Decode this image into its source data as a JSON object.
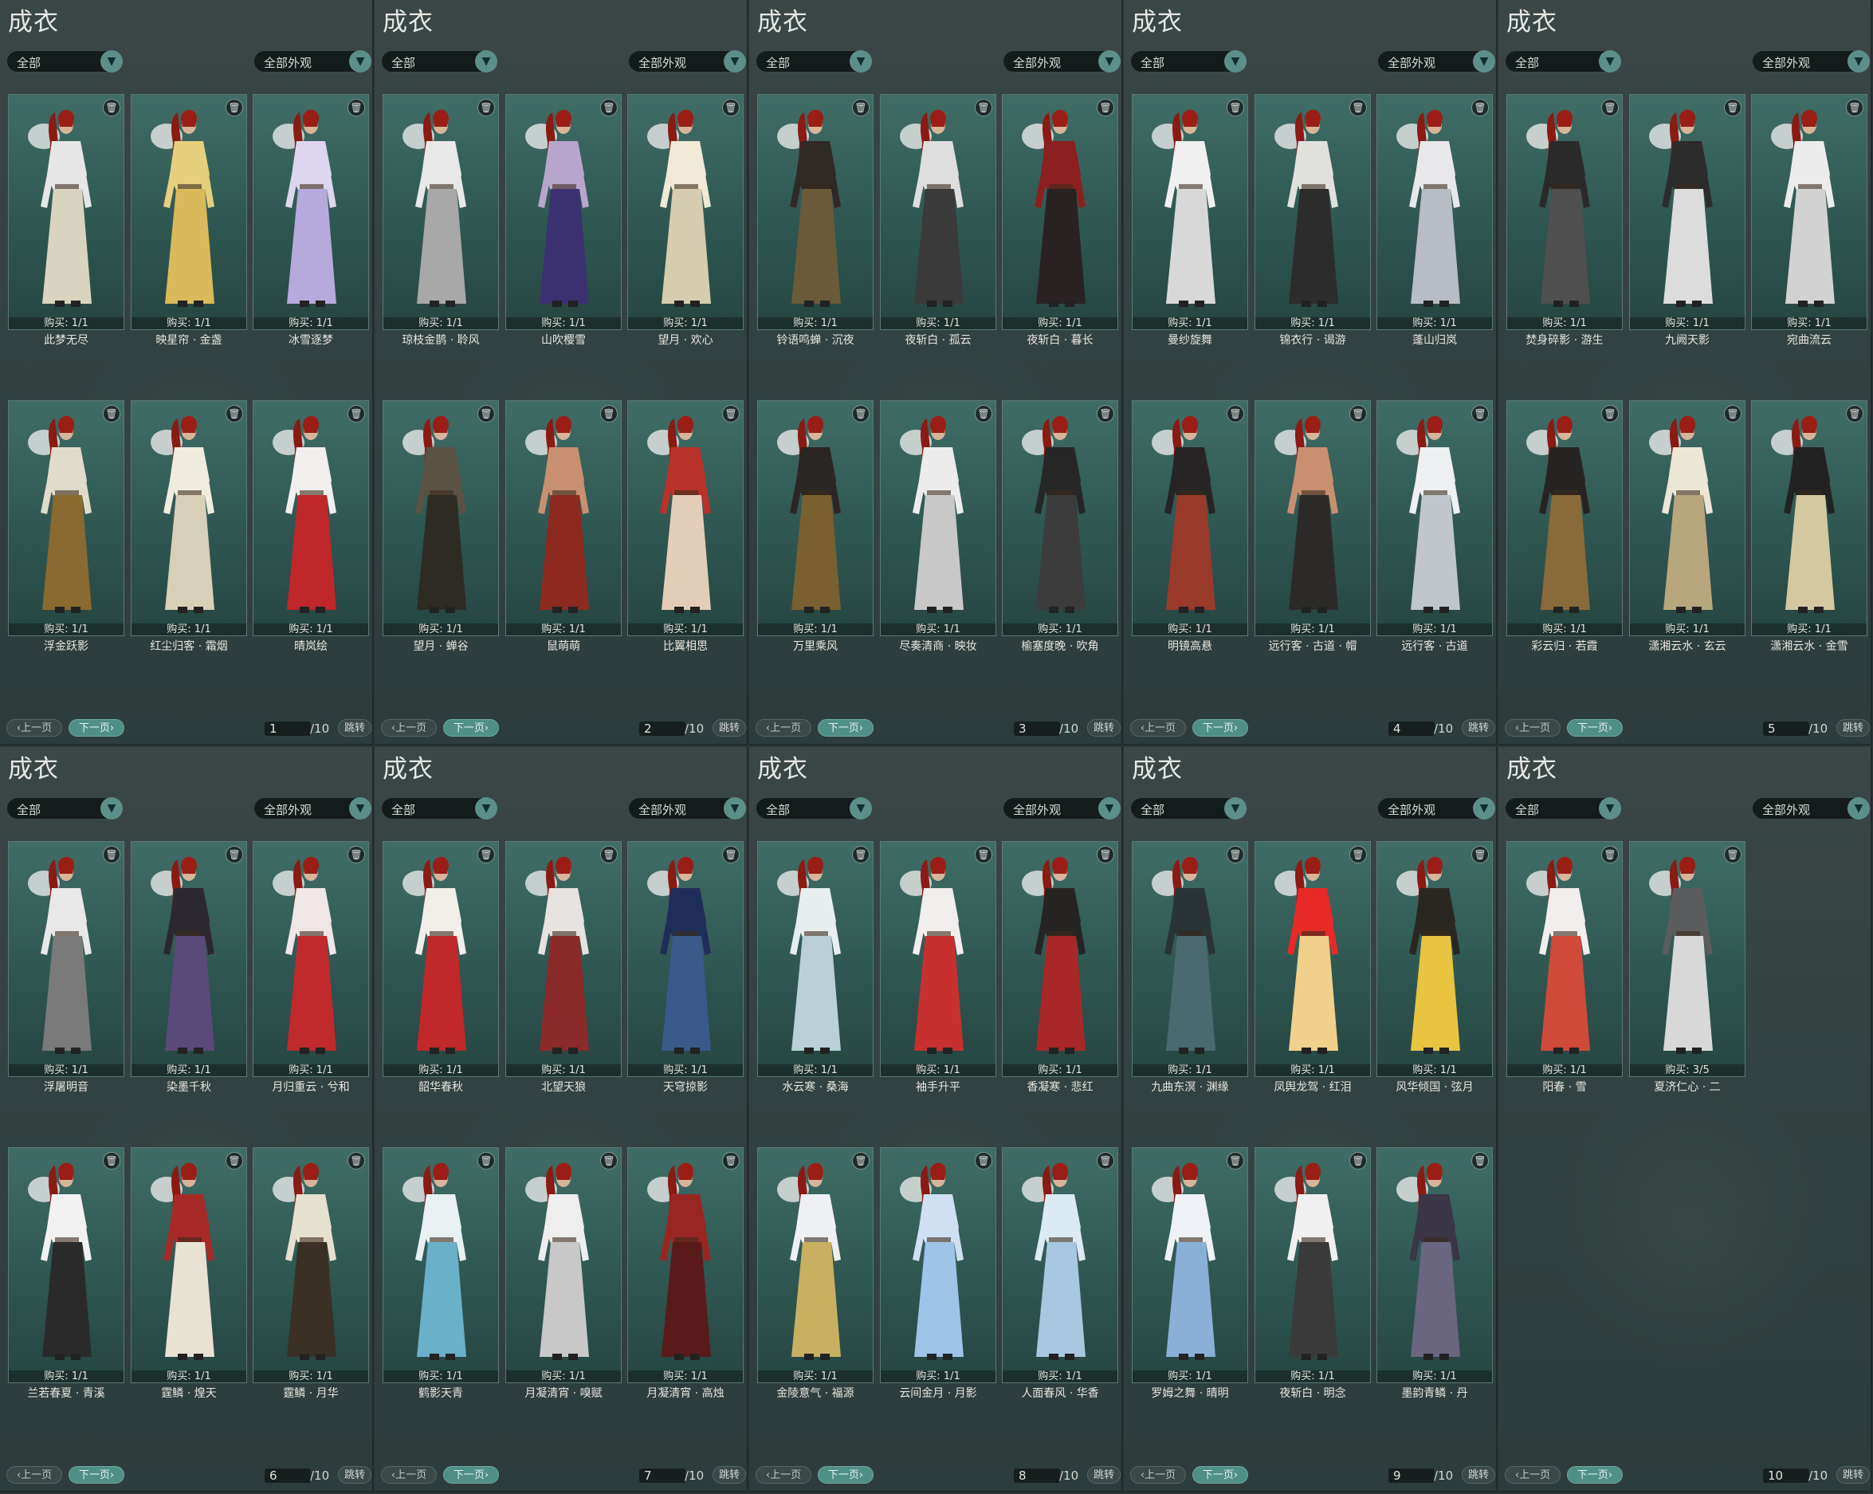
{
  "ui": {
    "title": "成衣",
    "filter_all": "全部",
    "filter_appearance": "全部外观",
    "prev": "上一页",
    "next": "下一页",
    "jump": "跳转",
    "total": "/10",
    "trash_icon": "trash-icon",
    "dropdown_icon": "chevron-down-icon"
  },
  "colors": {
    "accent": "#5d8f8a",
    "card": "#3f6d66",
    "panel": "#324141"
  },
  "pages": [
    {
      "page": "1",
      "items": [
        {
          "buy": "购买: 1/1",
          "name": "此梦无尽",
          "c1": "#e6e6e6",
          "c2": "#d9d4c0"
        },
        {
          "buy": "购买: 1/1",
          "name": "映星帘 · 金盏",
          "c1": "#e6cf7d",
          "c2": "#d9b95a"
        },
        {
          "buy": "购买: 1/1",
          "name": "冰雪逐梦",
          "c1": "#dcd6ee",
          "c2": "#b6a9dc"
        },
        {
          "buy": "购买: 1/1",
          "name": "浮金跃影",
          "c1": "#e0dccd",
          "c2": "#8a6a30"
        },
        {
          "buy": "购买: 1/1",
          "name": "红尘归客 · 霜烟",
          "c1": "#f0ece0",
          "c2": "#d8cfb8"
        },
        {
          "buy": "购买: 1/1",
          "name": "晴岚绘",
          "c1": "#f2eeee",
          "c2": "#c0272a"
        }
      ]
    },
    {
      "page": "2",
      "items": [
        {
          "buy": "购买: 1/1",
          "name": "琼枝金鹊 · 聆风",
          "c1": "#e8e8e8",
          "c2": "#a8a8a8"
        },
        {
          "buy": "购买: 1/1",
          "name": "山吹樱雪",
          "c1": "#b8a5cc",
          "c2": "#3b3170"
        },
        {
          "buy": "购买: 1/1",
          "name": "望月 · 欢心",
          "c1": "#efe9d6",
          "c2": "#d6ccaf"
        },
        {
          "buy": "购买: 1/1",
          "name": "望月 · 蝉谷",
          "c1": "#5b5246",
          "c2": "#2e2a24"
        },
        {
          "buy": "购买: 1/1",
          "name": "鼠萌萌",
          "c1": "#c89070",
          "c2": "#8c2a20"
        },
        {
          "buy": "购买: 1/1",
          "name": "比翼相思",
          "c1": "#b8322a",
          "c2": "#e4cdb8"
        }
      ]
    },
    {
      "page": "3",
      "items": [
        {
          "buy": "购买: 1/1",
          "name": "铃语鸣蝉 · 沉夜",
          "c1": "#2f2a26",
          "c2": "#6a5a3a"
        },
        {
          "buy": "购买: 1/1",
          "name": "夜斩白 · 孤云",
          "c1": "#dedede",
          "c2": "#3a3a3a"
        },
        {
          "buy": "购买: 1/1",
          "name": "夜斩白 · 暮长",
          "c1": "#8c1f20",
          "c2": "#2a2222"
        },
        {
          "buy": "购买: 1/1",
          "name": "万里乘风",
          "c1": "#2a2624",
          "c2": "#7a6030"
        },
        {
          "buy": "购买: 1/1",
          "name": "尽奏清商 · 映妆",
          "c1": "#ececec",
          "c2": "#c8c8c8"
        },
        {
          "buy": "购买: 1/1",
          "name": "榆塞度晚 · 吹角",
          "c1": "#262626",
          "c2": "#3c3c3c"
        }
      ]
    },
    {
      "page": "4",
      "items": [
        {
          "buy": "购买: 1/1",
          "name": "曼纱旋舞",
          "c1": "#f0f0f0",
          "c2": "#d8d8d8"
        },
        {
          "buy": "购买: 1/1",
          "name": "锦衣行 · 谒游",
          "c1": "#e0e0dc",
          "c2": "#2c2c2c"
        },
        {
          "buy": "购买: 1/1",
          "name": "蓬山归岚",
          "c1": "#e8e8ea",
          "c2": "#b8bcc4"
        },
        {
          "buy": "购买: 1/1",
          "name": "明镜高悬",
          "c1": "#262424",
          "c2": "#9a3a2a"
        },
        {
          "buy": "购买: 1/1",
          "name": "远行客 · 古道 · 帽",
          "c1": "#c89070",
          "c2": "#2c2a28"
        },
        {
          "buy": "购买: 1/1",
          "name": "远行客 · 古道",
          "c1": "#eef0f2",
          "c2": "#c0c6cc"
        }
      ]
    },
    {
      "page": "5",
      "items": [
        {
          "buy": "购买: 1/1",
          "name": "焚身碎影 · 游生",
          "c1": "#2a2a2a",
          "c2": "#505050"
        },
        {
          "buy": "购买: 1/1",
          "name": "九阙天影",
          "c1": "#2c2c2c",
          "c2": "#dcdcdc"
        },
        {
          "buy": "购买: 1/1",
          "name": "宛曲流云",
          "c1": "#ececec",
          "c2": "#d2d2d2"
        },
        {
          "buy": "购买: 1/1",
          "name": "彩云归 · 若霞",
          "c1": "#262422",
          "c2": "#8a6a3a"
        },
        {
          "buy": "购买: 1/1",
          "name": "潇湘云水 · 玄云",
          "c1": "#ebe6d6",
          "c2": "#b8a77c"
        },
        {
          "buy": "购买: 1/1",
          "name": "潇湘云水 · 金雪",
          "c1": "#222222",
          "c2": "#d4c8a0"
        }
      ]
    },
    {
      "page": "6",
      "items": [
        {
          "buy": "购买: 1/1",
          "name": "浮屠明音",
          "c1": "#e8e8e8",
          "c2": "#7a7a7a"
        },
        {
          "buy": "购买: 1/1",
          "name": "染墨千秋",
          "c1": "#2c2830",
          "c2": "#5a4a7a"
        },
        {
          "buy": "购买: 1/1",
          "name": "月归重云 · 兮和",
          "c1": "#f0e6e6",
          "c2": "#c02a2c"
        },
        {
          "buy": "购买: 1/1",
          "name": "兰若春夏 · 青溪",
          "c1": "#f2f2f2",
          "c2": "#2a2a2a"
        },
        {
          "buy": "购买: 1/1",
          "name": "霆鳞 · 煌天",
          "c1": "#a82a28",
          "c2": "#e8e2d4"
        },
        {
          "buy": "购买: 1/1",
          "name": "霆鳞 · 月华",
          "c1": "#e6e0d0",
          "c2": "#3a3026"
        }
      ]
    },
    {
      "page": "7",
      "items": [
        {
          "buy": "购买: 1/1",
          "name": "韶华春秋",
          "c1": "#f2eeea",
          "c2": "#c0282a"
        },
        {
          "buy": "购买: 1/1",
          "name": "北望天狼",
          "c1": "#e6e2e0",
          "c2": "#8a2a2a"
        },
        {
          "buy": "购买: 1/1",
          "name": "天穹掠影",
          "c1": "#1f2e58",
          "c2": "#3a5a8a"
        },
        {
          "buy": "购买: 1/1",
          "name": "鹤影天青",
          "c1": "#e8f0f2",
          "c2": "#6ab0c8"
        },
        {
          "buy": "购买: 1/1",
          "name": "月凝清宵 · 嗅赋",
          "c1": "#eeeeee",
          "c2": "#c8c8c8"
        },
        {
          "buy": "购买: 1/1",
          "name": "月凝清宵 · 高烛",
          "c1": "#9a2624",
          "c2": "#5a1a1a"
        }
      ]
    },
    {
      "page": "8",
      "items": [
        {
          "buy": "购买: 1/1",
          "name": "水云寒 · 桑海",
          "c1": "#e6eef0",
          "c2": "#b8d0d6"
        },
        {
          "buy": "购买: 1/1",
          "name": "袖手升平",
          "c1": "#f2eeee",
          "c2": "#c83030"
        },
        {
          "buy": "购买: 1/1",
          "name": "香凝寒 · 悲红",
          "c1": "#262422",
          "c2": "#a8282a"
        },
        {
          "buy": "购买: 1/1",
          "name": "金陵意气 · 福源",
          "c1": "#eef0f4",
          "c2": "#c8b060"
        },
        {
          "buy": "购买: 1/1",
          "name": "云间金月 · 月影",
          "c1": "#cfe0f2",
          "c2": "#9ec4e8"
        },
        {
          "buy": "购买: 1/1",
          "name": "人面春风 · 华香",
          "c1": "#dceaf4",
          "c2": "#a8c8e0"
        }
      ]
    },
    {
      "page": "9",
      "items": [
        {
          "buy": "购买: 1/1",
          "name": "九曲东溟 · 渊缘",
          "c1": "#2a3436",
          "c2": "#4a6a70"
        },
        {
          "buy": "购买: 1/1",
          "name": "凤舆龙驾 · 红泪",
          "c1": "#e82a26",
          "c2": "#f0d08a"
        },
        {
          "buy": "购买: 1/1",
          "name": "风华倾国 · 弦月",
          "c1": "#2a2622",
          "c2": "#e8c440"
        },
        {
          "buy": "购买: 1/1",
          "name": "罗姆之舞 · 晴明",
          "c1": "#eef2f6",
          "c2": "#8ab0d8"
        },
        {
          "buy": "购买: 1/1",
          "name": "夜斩白 · 明念",
          "c1": "#f0f0f0",
          "c2": "#3a3a3a"
        },
        {
          "buy": "购买: 1/1",
          "name": "墨韵青鳞 · 丹",
          "c1": "#3a3646",
          "c2": "#6a6680"
        }
      ]
    },
    {
      "page": "10",
      "items": [
        {
          "buy": "购买: 1/1",
          "name": "阳春 · 雪",
          "c1": "#f2eeee",
          "c2": "#d04a3a"
        },
        {
          "buy": "购买: 3/5",
          "name": "夏济仁心 · 二",
          "c1": "#5a5c5e",
          "c2": "#d8d8d8"
        }
      ]
    }
  ]
}
